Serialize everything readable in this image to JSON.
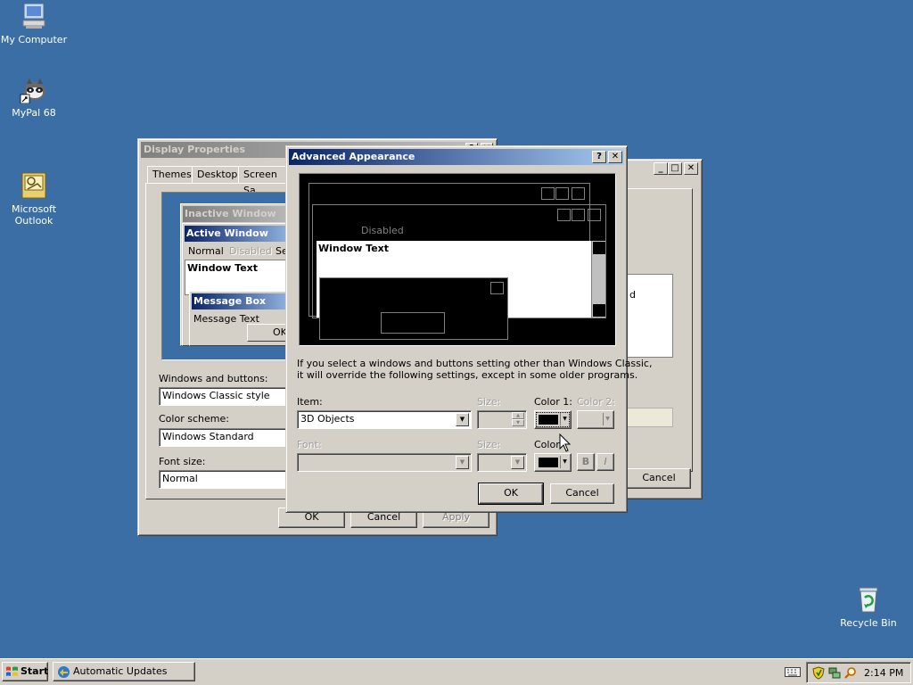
{
  "desktop": {
    "icons": [
      {
        "label": "My Computer"
      },
      {
        "label": "MyPal 68"
      },
      {
        "label": "Microsoft\nOutlook"
      },
      {
        "label": "Recycle Bin"
      }
    ]
  },
  "display_properties": {
    "title": "Display Properties",
    "tabs": [
      "Themes",
      "Desktop",
      "Screen Sa"
    ],
    "preview": {
      "inactive_title": "Inactive Window",
      "active_title": "Active Window",
      "menu_normal": "Normal",
      "menu_disabled": "Disabled",
      "menu_selected": "Se",
      "window_text": "Window Text",
      "msgbox_title": "Message Box",
      "msgbox_text": "Message Text",
      "msgbox_ok": "OK"
    },
    "windows_buttons_label": "Windows and buttons:",
    "windows_buttons_value": "Windows Classic style",
    "color_scheme_label": "Color scheme:",
    "color_scheme_value": "Windows Standard",
    "font_size_label": "Font size:",
    "font_size_value": "Normal",
    "ok_label": "OK",
    "cancel_label": "Cancel",
    "apply_label": "Apply"
  },
  "back_window": {
    "partial_text": "d",
    "cancel_label": "Cancel"
  },
  "advanced": {
    "title": "Advanced Appearance",
    "help_btn": "?",
    "close_btn": "✕",
    "preview": {
      "disabled_text": "Disabled",
      "window_text": "Window Text"
    },
    "info_line1": "If you select a windows and buttons setting other than Windows Classic,",
    "info_line2": "it will override the following settings, except in some older programs.",
    "item_label": "Item:",
    "item_value": "3D Objects",
    "size_label": "Size:",
    "color1_label": "Color 1:",
    "color2_label": "Color 2:",
    "font_label": "Font:",
    "size2_label": "Size:",
    "color_label": "Color:",
    "bold_label": "B",
    "italic_label": "I",
    "ok_label": "OK",
    "cancel_label": "Cancel",
    "color1_swatch": "#000000",
    "font_color_swatch": "#000000"
  },
  "taskbar": {
    "start_label": "Start",
    "task_label": "Automatic Updates",
    "clock": "2:14 PM"
  },
  "colors": {
    "desktop": "#3a6ea5",
    "face": "#d4d0c8",
    "active_title": "#0a246a"
  }
}
